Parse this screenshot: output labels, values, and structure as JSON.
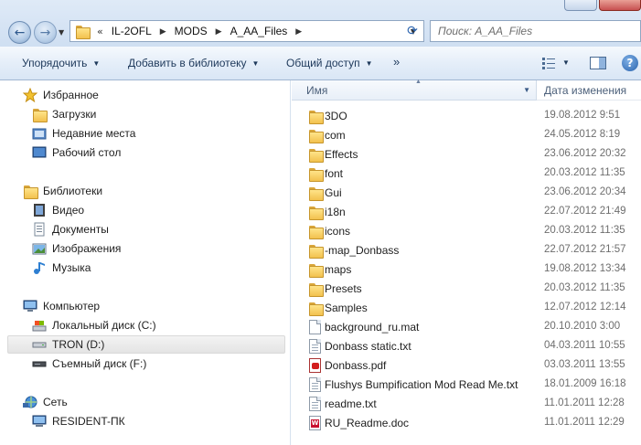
{
  "address": {
    "crumbs": [
      "IL-2OFL",
      "MODS",
      "A_AA_Files"
    ],
    "overflow": "«"
  },
  "search": {
    "placeholder": "Поиск: A_AA_Files"
  },
  "toolbar": {
    "organize": "Упорядочить",
    "add_to_library": "Добавить в библиотеку",
    "share": "Общий доступ",
    "more": "»"
  },
  "nav": {
    "favorites": {
      "label": "Избранное",
      "items": [
        "Загрузки",
        "Недавние места",
        "Рабочий стол"
      ]
    },
    "libraries": {
      "label": "Библиотеки",
      "items": [
        "Видео",
        "Документы",
        "Изображения",
        "Музыка"
      ]
    },
    "computer": {
      "label": "Компьютер",
      "items": [
        "Локальный диск (C:)",
        "TRON (D:)",
        "Съемный диск (F:)"
      ]
    },
    "network": {
      "label": "Сеть",
      "items": [
        "RESIDENT-ПК"
      ]
    }
  },
  "columns": {
    "name": "Имя",
    "date": "Дата изменения"
  },
  "files": [
    {
      "name": "3DO",
      "date": "19.08.2012 9:51",
      "type": "folder"
    },
    {
      "name": "com",
      "date": "24.05.2012 8:19",
      "type": "folder"
    },
    {
      "name": "Effects",
      "date": "23.06.2012 20:32",
      "type": "folder"
    },
    {
      "name": "font",
      "date": "20.03.2012 11:35",
      "type": "folder"
    },
    {
      "name": "Gui",
      "date": "23.06.2012 20:34",
      "type": "folder"
    },
    {
      "name": "i18n",
      "date": "22.07.2012 21:49",
      "type": "folder"
    },
    {
      "name": "icons",
      "date": "20.03.2012 11:35",
      "type": "folder"
    },
    {
      "name": "-map_Donbass",
      "date": "22.07.2012 21:57",
      "type": "folder"
    },
    {
      "name": "maps",
      "date": "19.08.2012 13:34",
      "type": "folder"
    },
    {
      "name": "Presets",
      "date": "20.03.2012 11:35",
      "type": "folder"
    },
    {
      "name": "Samples",
      "date": "12.07.2012 12:14",
      "type": "folder"
    },
    {
      "name": "background_ru.mat",
      "date": "20.10.2010 3:00",
      "type": "file"
    },
    {
      "name": "Donbass static.txt",
      "date": "04.03.2011 10:55",
      "type": "text"
    },
    {
      "name": "Donbass.pdf",
      "date": "03.03.2011 13:55",
      "type": "pdf"
    },
    {
      "name": "Flushys Bumpification Mod Read Me.txt",
      "date": "18.01.2009 16:18",
      "type": "text"
    },
    {
      "name": "readme.txt",
      "date": "11.01.2011 12:28",
      "type": "text"
    },
    {
      "name": "RU_Readme.doc",
      "date": "11.01.2011 12:29",
      "type": "word"
    }
  ]
}
